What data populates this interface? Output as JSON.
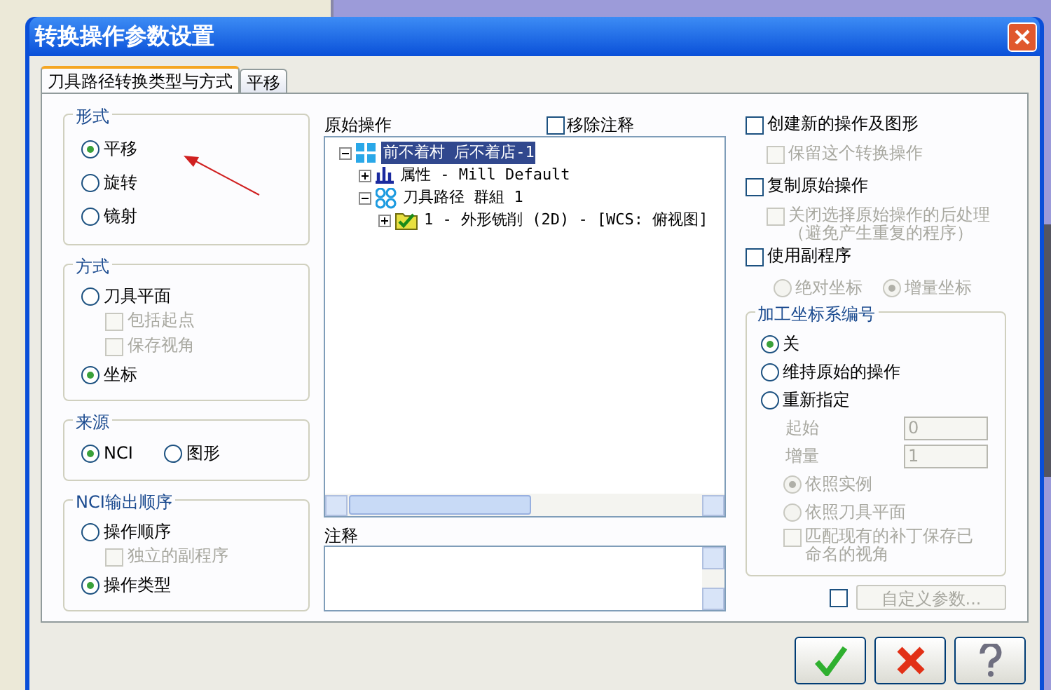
{
  "window": {
    "title": "转换操作参数设置"
  },
  "tabs": [
    {
      "label": "刀具路径转换类型与方式",
      "selected": true
    },
    {
      "label": "平移",
      "selected": false
    }
  ],
  "form_group": {
    "title": "形式",
    "options": [
      {
        "label": "平移",
        "selected": true
      },
      {
        "label": "旋转",
        "selected": false
      },
      {
        "label": "镜射",
        "selected": false
      }
    ]
  },
  "method_group": {
    "title": "方式",
    "items": [
      {
        "kind": "radio",
        "label": "刀具平面",
        "selected": false,
        "disabled": false
      },
      {
        "kind": "checkbox",
        "label": "包括起点",
        "checked": false,
        "disabled": true
      },
      {
        "kind": "checkbox",
        "label": "保存视角",
        "checked": false,
        "disabled": true
      },
      {
        "kind": "radio",
        "label": "坐标",
        "selected": true,
        "disabled": false
      }
    ]
  },
  "source_group": {
    "title": "来源",
    "options": [
      {
        "label": "NCI",
        "selected": true
      },
      {
        "label": "图形",
        "selected": false
      }
    ]
  },
  "nci_order_group": {
    "title": "NCI输出顺序",
    "items": [
      {
        "kind": "radio",
        "label": "操作顺序",
        "selected": false,
        "disabled": false
      },
      {
        "kind": "checkbox",
        "label": "独立的副程序",
        "checked": false,
        "disabled": true
      },
      {
        "kind": "radio",
        "label": "操作类型",
        "selected": true,
        "disabled": false
      }
    ]
  },
  "original_ops": {
    "title": "原始操作",
    "remove_comments": {
      "label": "移除注释",
      "checked": false
    },
    "tree": [
      {
        "kind": "machine",
        "label": "前不着村 后不着店-1",
        "selected": true,
        "expanded": true,
        "children": [
          {
            "kind": "properties",
            "label": "属性 - Mill Default",
            "selected": false,
            "expanded": false
          },
          {
            "kind": "group",
            "label": "刀具路径 群組 1",
            "selected": false,
            "expanded": true,
            "children": [
              {
                "kind": "operation",
                "label": "1 - 外形铣削 (2D) - [WCS: 俯视图]",
                "selected": false,
                "expanded": false
              }
            ]
          }
        ]
      }
    ]
  },
  "comments": {
    "label": "注释"
  },
  "right_options": [
    {
      "kind": "checkbox",
      "label": "创建新的操作及图形",
      "checked": false,
      "disabled": false
    },
    {
      "kind": "subcheckbox",
      "label": "保留这个转换操作",
      "checked": false,
      "disabled": true
    },
    {
      "kind": "checkbox",
      "label": "复制原始操作",
      "checked": false,
      "disabled": false
    },
    {
      "kind": "subcheckbox",
      "label": "关闭选择原始操作的后处理（避免产生重复的程序）",
      "checked": false,
      "disabled": true
    },
    {
      "kind": "checkbox",
      "label": "使用副程序",
      "checked": false,
      "disabled": false
    },
    {
      "kind": "radios",
      "disabled": true,
      "options": [
        {
          "label": "绝对坐标",
          "selected": false
        },
        {
          "label": "增量坐标",
          "selected": true
        }
      ]
    }
  ],
  "wcs_group": {
    "title": "加工坐标系编号",
    "options": [
      {
        "label": "关",
        "selected": true
      },
      {
        "label": "维持原始的操作",
        "selected": false
      },
      {
        "label": "重新指定",
        "selected": false
      }
    ],
    "fields": [
      {
        "label": "起始",
        "value": "0",
        "disabled": true
      },
      {
        "label": "增量",
        "value": "1",
        "disabled": true
      }
    ],
    "sub_options": [
      {
        "label": "依照实例",
        "selected": true,
        "disabled": true
      },
      {
        "label": "依照刀具平面",
        "selected": false,
        "disabled": true
      }
    ],
    "match_views": {
      "label": "匹配现有的补丁保存已命名的视角",
      "checked": false,
      "disabled": true
    }
  },
  "custom": {
    "checked": false,
    "button": "自定义参数...",
    "disabled": true
  },
  "buttons": [
    {
      "kind": "ok"
    },
    {
      "kind": "cancel"
    },
    {
      "kind": "help"
    }
  ]
}
